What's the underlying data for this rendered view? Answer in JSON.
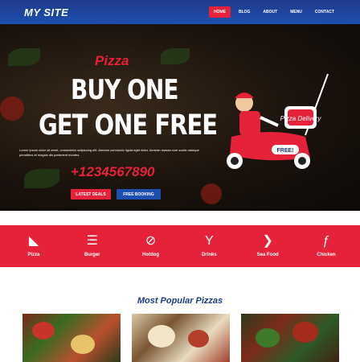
{
  "header": {
    "logo": "MY SITE",
    "nav": [
      {
        "label": "Home",
        "active": true
      },
      {
        "label": "Blog",
        "active": false
      },
      {
        "label": "About",
        "active": false
      },
      {
        "label": "Menu",
        "active": false
      },
      {
        "label": "Contact",
        "active": false
      }
    ]
  },
  "hero": {
    "tag": "Pizza",
    "line1": "BUY ONE",
    "line2": "GET ONE FREE",
    "description": "Lorem ipsum dolor sit amet, consectetur adipiscing elit. Aenean commodo ligula eget dolor. Aenean massa cum sociis natoque penatibus et magnis dis parturient montes.",
    "phone": "+1234567890",
    "buttons": {
      "primary": "Latest Deals",
      "secondary": "Free Booking"
    },
    "scooter_label": "FREE!",
    "box_label": "Pizza Delivery"
  },
  "categories": [
    {
      "label": "Pizza",
      "icon": "pizza-slice-icon",
      "glyph": "◣"
    },
    {
      "label": "Burger",
      "icon": "burger-icon",
      "glyph": "☰"
    },
    {
      "label": "Hotdog",
      "icon": "hotdog-icon",
      "glyph": "⊘"
    },
    {
      "label": "Drinks",
      "icon": "cocktail-icon",
      "glyph": "Y"
    },
    {
      "label": "Sea Food",
      "icon": "fish-icon",
      "glyph": "❯"
    },
    {
      "label": "Chicken",
      "icon": "drumstick-icon",
      "glyph": "ƒ"
    }
  ],
  "popular": {
    "title": "Most Popular Pizzas"
  },
  "colors": {
    "primary": "#1e4fb0",
    "accent": "#e5223a"
  }
}
